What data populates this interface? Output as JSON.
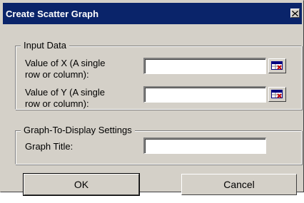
{
  "window": {
    "title": "Create Scatter Graph",
    "close_icon": "close-icon"
  },
  "input_data": {
    "legend": "Input Data",
    "x_label_line1": "Value of X (A single",
    "x_label_line2": "row or column):",
    "x_value": "",
    "y_label_line1": "Value of Y (A single",
    "y_label_line2": "row or column):",
    "y_value": "",
    "range_picker_icon": "range-select-icon"
  },
  "graph_settings": {
    "legend": "Graph-To-Display Settings",
    "title_label": "Graph Title:",
    "title_value": ""
  },
  "buttons": {
    "ok_label": "OK",
    "cancel_label": "Cancel"
  },
  "colors": {
    "titlebar": "#0a246a",
    "dialog_face": "#d4d0c8"
  }
}
